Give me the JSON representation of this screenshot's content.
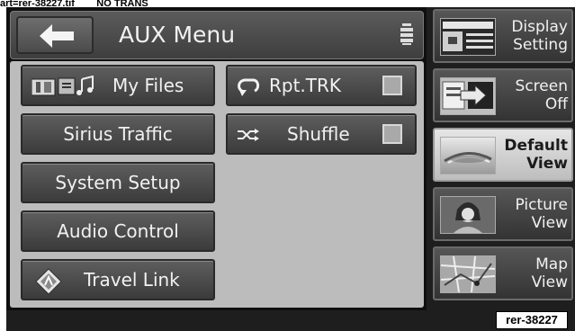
{
  "header_label": "art=rer-38227.tif        NO TRANS",
  "title_bar": {
    "title": "AUX Menu"
  },
  "left_buttons": [
    {
      "label": "My Files",
      "icon": "my-files-icon"
    },
    {
      "label": "Sirius Traffic"
    },
    {
      "label": "System Setup"
    },
    {
      "label": "Audio Control"
    },
    {
      "label": "Travel Link",
      "icon": "travel-link-icon"
    }
  ],
  "right_buttons": [
    {
      "label": "Rpt.TRK",
      "icon": "repeat-icon",
      "checked": false
    },
    {
      "label": "Shuffle",
      "icon": "shuffle-icon",
      "checked": false
    }
  ],
  "sidebar": [
    {
      "label": "Display Setting",
      "icon": "display-setting-icon",
      "active": false
    },
    {
      "label": "Screen Off",
      "icon": "screen-off-icon",
      "active": false
    },
    {
      "label": "Default View",
      "icon": "default-view-icon",
      "active": true
    },
    {
      "label": "Picture View",
      "icon": "picture-view-icon",
      "active": false
    },
    {
      "label": "Map View",
      "icon": "map-view-icon",
      "active": false
    }
  ],
  "figure_ref": "rer-38227",
  "colors": {
    "button": "#4a4a4a",
    "panel": "#bcbcbc",
    "active": "#d6d6d6",
    "text": "#f1f1f1"
  }
}
